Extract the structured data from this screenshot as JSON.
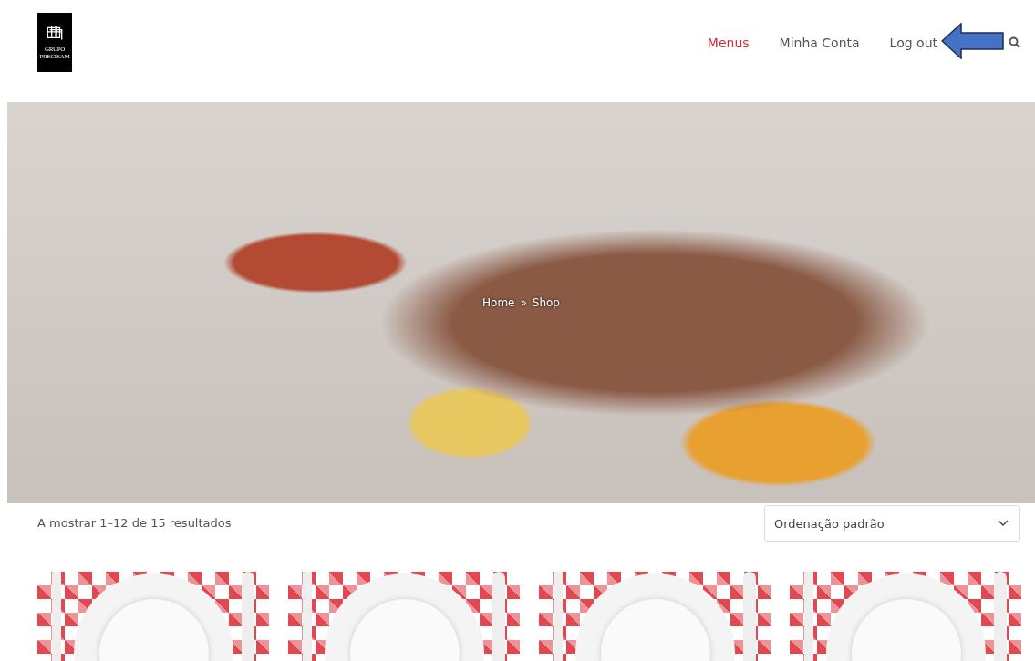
{
  "logo": {
    "lines": [
      "GRUPO",
      "PRECIEAM"
    ]
  },
  "nav": [
    {
      "label": "Menus",
      "selected": true
    },
    {
      "label": "Minha Conta",
      "selected": false
    },
    {
      "label": "Log out",
      "selected": false
    }
  ],
  "annotation": {
    "kind": "arrow"
  },
  "hero": {
    "breadcrumb": [
      "Home",
      "»",
      "Shop"
    ]
  },
  "results": "A mostrar 1–12 de 15 resultados",
  "sort": {
    "value": "Ordenação padrão"
  },
  "products": [
    {
      "kind": "menu"
    },
    {
      "kind": "menu"
    },
    {
      "kind": "menu"
    },
    {
      "kind": "menu"
    }
  ]
}
